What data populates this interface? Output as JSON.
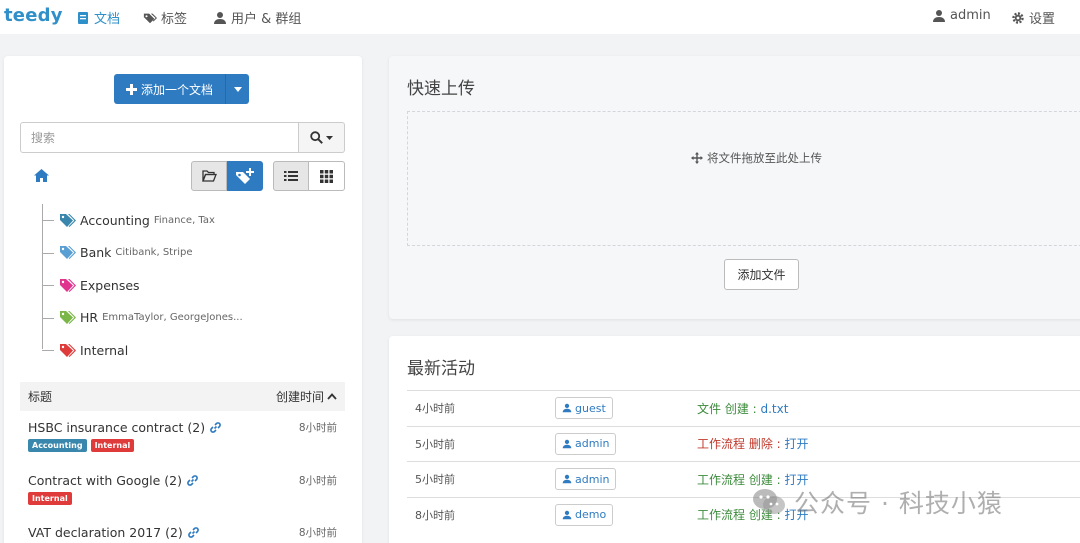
{
  "nav": {
    "brand": "teedy",
    "documents": "文档",
    "tags": "标签",
    "users_groups": "用户 & 群组",
    "user": "admin",
    "settings": "设置"
  },
  "sidebar": {
    "add_document": "添加一个文档",
    "search_placeholder": "搜索",
    "tags": [
      {
        "name": "Accounting",
        "sub": "Finance, Tax",
        "color": "#3a87ad"
      },
      {
        "name": "Bank",
        "sub": "Citibank, Stripe",
        "color": "#5a9fd4"
      },
      {
        "name": "Expenses",
        "sub": "",
        "color": "#e0358f"
      },
      {
        "name": "HR",
        "sub": "EmmaTaylor, GeorgeJones...",
        "color": "#7ab648"
      },
      {
        "name": "Internal",
        "sub": "",
        "color": "#e03b3b"
      }
    ],
    "doc_list": {
      "col_title": "标题",
      "col_created": "创建时间",
      "docs": [
        {
          "title": "HSBC insurance contract (2)",
          "time": "8小时前",
          "badges": [
            {
              "label": "Accounting",
              "color": "#3a87ad"
            },
            {
              "label": "Internal",
              "color": "#e03b3b"
            }
          ]
        },
        {
          "title": "Contract with Google (2)",
          "time": "8小时前",
          "badges": [
            {
              "label": "Internal",
              "color": "#e03b3b"
            }
          ]
        },
        {
          "title": "VAT declaration 2017 (2)",
          "time": "8小时前",
          "badges": []
        }
      ]
    }
  },
  "upload": {
    "title": "快速上传",
    "drop_text": "将文件拖放至此处上传",
    "add_file": "添加文件"
  },
  "activity": {
    "title": "最新活动",
    "rows": [
      {
        "time": "4小时前",
        "user": "guest",
        "desc": "文件 创建 : ",
        "target": "d.txt",
        "color": "#3c8b3c"
      },
      {
        "time": "5小时前",
        "user": "admin",
        "desc": "工作流程 删除 : ",
        "target": "打开",
        "color": "#c0392b"
      },
      {
        "time": "5小时前",
        "user": "admin",
        "desc": "工作流程 创建 : ",
        "target": "打开",
        "color": "#3c8b3c"
      },
      {
        "time": "8小时前",
        "user": "demo",
        "desc": "工作流程 创建 : ",
        "target": "打开",
        "color": "#3c8b3c"
      }
    ]
  },
  "watermark": "公众号 · 科技小猿"
}
